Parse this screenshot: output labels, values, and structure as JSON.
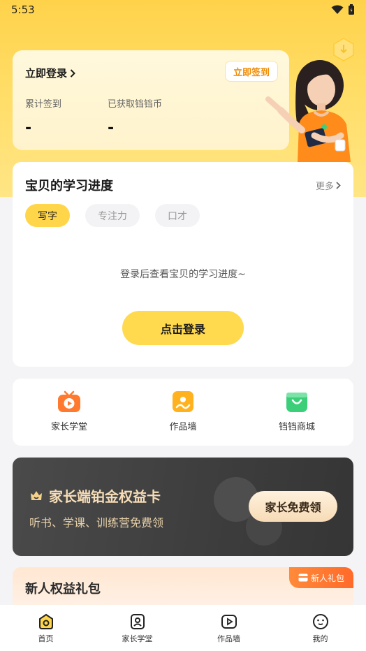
{
  "status_bar": {
    "time": "5:53"
  },
  "login_card": {
    "login_link": "立即登录",
    "checkin_button": "立即签到",
    "stats": [
      {
        "label": "累计签到",
        "value": "-"
      },
      {
        "label": "已获取铛铛币",
        "value": "-"
      }
    ]
  },
  "progress": {
    "title": "宝贝的学习进度",
    "more": "更多",
    "tabs": [
      "写字",
      "专注力",
      "口才"
    ],
    "active_tab": "写字",
    "empty_hint": "登录后查看宝贝的学习进度~",
    "login_button": "点击登录"
  },
  "shortcuts": [
    {
      "label": "家长学堂",
      "icon": "tv-play-icon",
      "color": "#ff7a2e"
    },
    {
      "label": "作品墙",
      "icon": "artwork-icon",
      "color": "#ffb21e"
    },
    {
      "label": "铛铛商城",
      "icon": "shopping-bag-icon",
      "color": "#3ccf7a"
    }
  ],
  "vip": {
    "title": "家长端铂金权益卡",
    "subtitle": "听书、学课、训练营免费领",
    "button": "家长免费领"
  },
  "gift": {
    "title": "新人权益礼包",
    "badge": "新人礼包"
  },
  "tabbar": [
    {
      "label": "首页",
      "icon": "home-icon",
      "active": true
    },
    {
      "label": "家长学堂",
      "icon": "parent-school-icon",
      "active": false
    },
    {
      "label": "作品墙",
      "icon": "video-play-icon",
      "active": false
    },
    {
      "label": "我的",
      "icon": "profile-face-icon",
      "active": false
    }
  ],
  "colors": {
    "brand_yellow": "#ffd54a",
    "accent_orange": "#f08a00",
    "vip_gold": "#f6dcb7"
  }
}
